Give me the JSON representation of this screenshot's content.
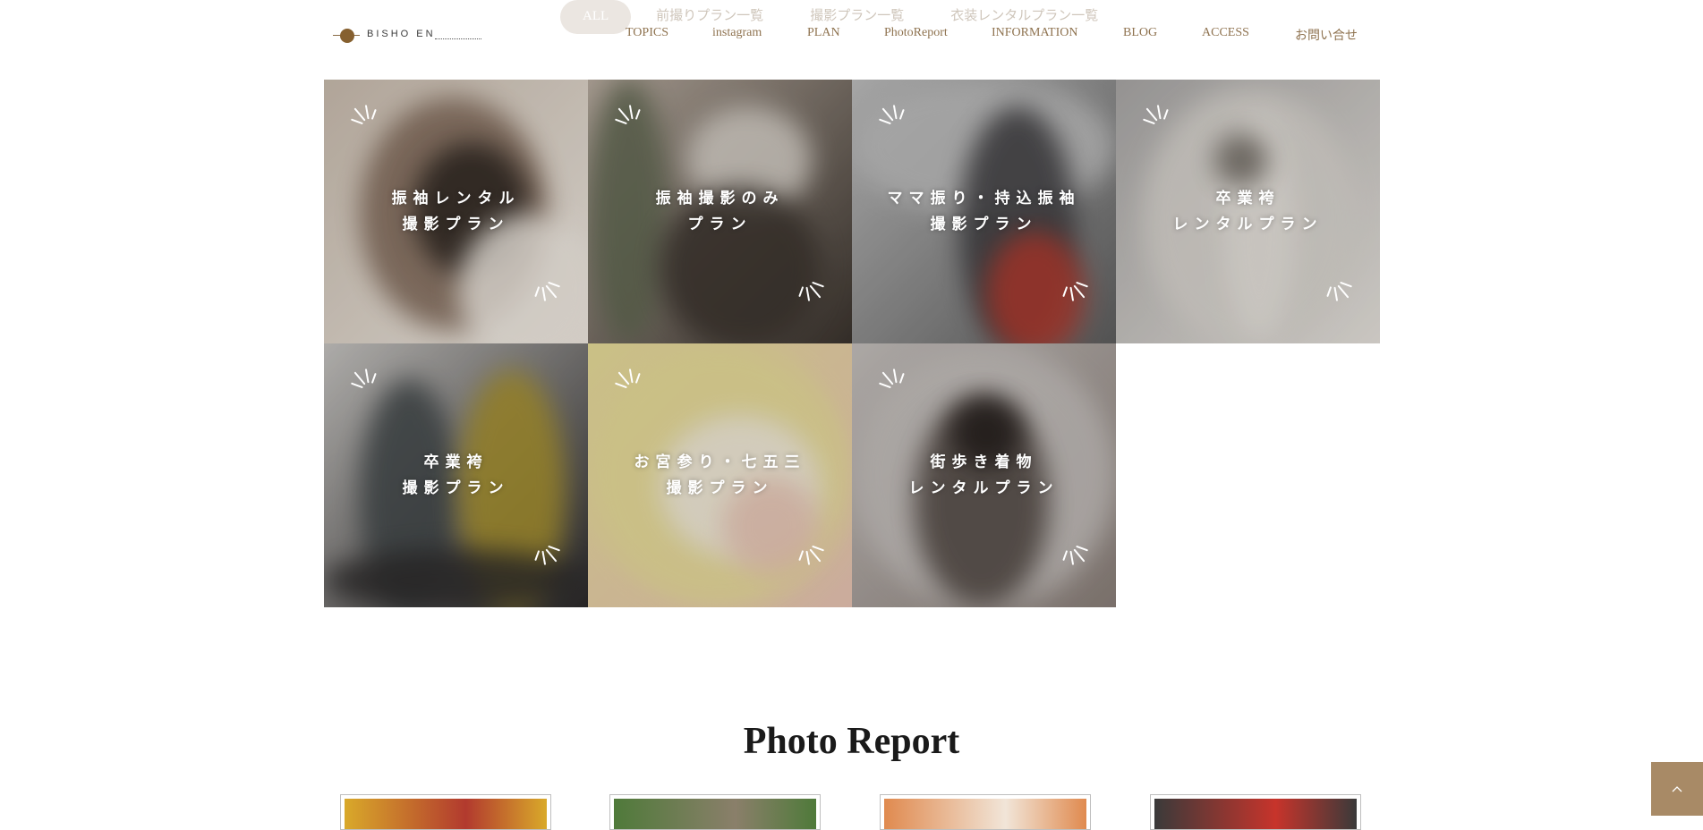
{
  "brand": {
    "logo_text": "BISHO EN",
    "accent_color": "#86602f"
  },
  "filter_tabs": [
    {
      "label": "ALL",
      "active": true
    },
    {
      "label": "前撮りプラン一覧",
      "active": false
    },
    {
      "label": "撮影プラン一覧",
      "active": false
    },
    {
      "label": "衣装レンタルプラン一覧",
      "active": false
    }
  ],
  "nav": [
    {
      "label": "TOPICS"
    },
    {
      "label": "instagram"
    },
    {
      "label": "PLAN"
    },
    {
      "label": "PhotoReport"
    },
    {
      "label": "INFORMATION"
    },
    {
      "label": "BLOG"
    },
    {
      "label": "ACCESS"
    },
    {
      "label": "お問い合せ"
    }
  ],
  "plans": [
    {
      "line1": "振袖レンタル",
      "line2": "撮影プラン",
      "palette": [
        "#c9bcae",
        "#7d6656",
        "#2b241f",
        "#efe9e1"
      ]
    },
    {
      "line1": "振袖撮影のみ",
      "line2": "プラン",
      "palette": [
        "#b8aca0",
        "#5f6650",
        "#d8d2ca",
        "#3a332d"
      ]
    },
    {
      "line1": "ママ振り・持込振袖",
      "line2": "撮影プラン",
      "palette": [
        "#bdbdbd",
        "#3b3a3d",
        "#b23a2e",
        "#5e5e5e"
      ]
    },
    {
      "line1": "卒業袴",
      "line2": "レンタルプラン",
      "palette": [
        "#a9a7a6",
        "#d9d5cf",
        "#6d6760",
        "#e6e2dc"
      ]
    },
    {
      "line1": "卒業袴",
      "line2": "撮影プラン",
      "palette": [
        "#c6c4c1",
        "#3f4547",
        "#a9922d",
        "#2c2a2a"
      ]
    },
    {
      "line1": "お宮参り・七五三",
      "line2": "撮影プラン",
      "palette": [
        "#e6dc98",
        "#f1ebe0",
        "#d4c067",
        "#e7c3b3"
      ]
    },
    {
      "line1": "街歩き着物",
      "line2": "レンタルプラン",
      "palette": [
        "#c4bfbc",
        "#4d443f",
        "#231d1b",
        "#8a7f79"
      ]
    }
  ],
  "photo_report": {
    "title": "Photo Report",
    "cards": [
      {
        "palette": [
          "#d9a92a",
          "#b23a2e"
        ]
      },
      {
        "palette": [
          "#4f7a3a",
          "#8a7f6a"
        ]
      },
      {
        "palette": [
          "#e08a4f",
          "#f1e5d8"
        ]
      },
      {
        "palette": [
          "#3a3a3a",
          "#c7342b"
        ]
      }
    ]
  }
}
